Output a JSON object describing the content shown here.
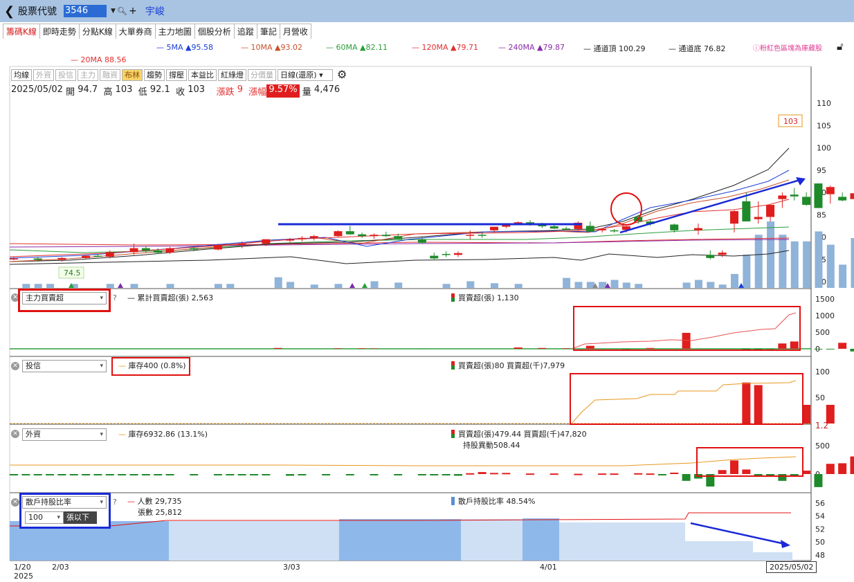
{
  "topbar": {
    "back_glyph": "❮",
    "label": "股票代號",
    "code": "3546",
    "stock_name": "宇峻"
  },
  "tabs": [
    "籌碼K線",
    "即時走勢",
    "分點K線",
    "大單券商",
    "主力地圖",
    "個股分析",
    "追蹤",
    "筆記",
    "月營收"
  ],
  "ma_legend": [
    {
      "label": "5MA ▲95.58",
      "color": "#1a3fd6"
    },
    {
      "label": "10MA ▲93.02",
      "color": "#c8502a"
    },
    {
      "label": "60MA ▲82.11",
      "color": "#2a9d3b"
    },
    {
      "label": "120MA ▲79.71",
      "color": "#e03030"
    },
    {
      "label": "240MA ▲79.87",
      "color": "#8a2aa8"
    },
    {
      "label": "通道頂 100.29",
      "color": "#222222"
    },
    {
      "label": "通道底 76.82",
      "color": "#222222"
    }
  ],
  "ma20": {
    "label": "20MA 88.56",
    "color": "#e03030"
  },
  "note": "ⓘ粉紅色區塊為庫藏股",
  "toolbar": {
    "buttons": [
      "均線",
      "外資",
      "投信",
      "主力",
      "融資",
      "布林",
      "趨勢",
      "撐壓",
      "本益比",
      "紅綠燈",
      "分價量"
    ],
    "dim": [
      false,
      true,
      true,
      true,
      true,
      false,
      false,
      false,
      false,
      false,
      true
    ],
    "active": [
      false,
      false,
      false,
      false,
      false,
      true,
      false,
      false,
      false,
      false,
      false
    ],
    "period": "日線(還原)"
  },
  "ohlc": {
    "date": "2025/05/02",
    "open_label": "開",
    "open": "94.7",
    "high_label": "高",
    "high": "103",
    "low_label": "低",
    "low": "92.1",
    "close_label": "收",
    "close": "103",
    "change_label": "漲跌",
    "change": "9",
    "pct_label": "漲幅",
    "pct": "9.57%",
    "vol_label": "量",
    "vol": "4,476"
  },
  "price_axis": [
    "110",
    "105",
    "100",
    "95",
    "90",
    "85",
    "80",
    "75",
    "70"
  ],
  "last_price_tag": "103",
  "low_tag": "74.5",
  "panels": {
    "main_force": {
      "select": "主力買賣超",
      "legend1": "累計買賣超(張) 2,563",
      "legend2": "買賣超(張) 1,130",
      "axis": [
        "1500",
        "1000",
        "500",
        "0"
      ]
    },
    "trust": {
      "select": "投信",
      "legend1": "庫存400 (0.8%)",
      "legend2": "買賣超(張)80 買賣超(千)7,979",
      "axis": [
        "100",
        "50",
        "1.2"
      ]
    },
    "foreign": {
      "select": "外資",
      "legend1": "庫存6932.86 (13.1%)",
      "legend2": "買賣超(張)479.44 買賣超(千)47,820",
      "legend3": "持股異動508.44",
      "axis": [
        "500",
        "0"
      ]
    },
    "retail": {
      "select": "散戶持股比率",
      "sub_select": "100",
      "sub_label": "張以下",
      "legend1": "人數 29,735",
      "legend2": "張數 25,812",
      "legend3": "散戶持股比率 48.54%",
      "axis": [
        "56",
        "54",
        "52",
        "50",
        "48"
      ]
    }
  },
  "date_axis": [
    "1/20",
    "2025",
    "2/03",
    "3/03",
    "4/01",
    "2025/05/02"
  ],
  "colors": {
    "up": "#e01e1e",
    "down": "#1f8a2a",
    "volume": "#8fb3d9",
    "annotation": "#e01010",
    "arrow": "#1a3fd6"
  },
  "chart_data": {
    "type": "candlestick",
    "ohlc_last": {
      "open": 94.7,
      "high": 103,
      "low": 92.1,
      "close": 103
    },
    "ylim": [
      69,
      111
    ]
  }
}
